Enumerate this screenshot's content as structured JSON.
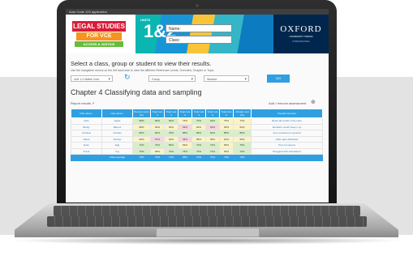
{
  "window": {
    "title": "Auto Code 123 application"
  },
  "banner": {
    "tag1": "LEGAL STUDIES",
    "tag2": "FOR VCE",
    "tag3": "ACCESS & JUSTICE",
    "units_label": "UNITS",
    "units_number": "1&2",
    "name_label": "Name:",
    "class_label": "Class:",
    "publisher": "OXFORD",
    "publisher_sub": "UNIVERSITY PRESS",
    "publisher_sub2": "INTRODUCING"
  },
  "select_heading": "Select a class, group or student to view their results.",
  "instructions": "Use the navigation menus on the left hand side to view the different Reference Levels, Overview, Chapter or Topic.",
  "filters": {
    "class": "Unit 1-2 Maths Core",
    "group": "Group",
    "student": "Student",
    "go": "GO"
  },
  "chapter_title": "Chapter 4 Classifying data and sampling",
  "export_label": "Report results",
  "add_remove_label": "Add / remove assessment",
  "table": {
    "headers": [
      "First name ↕",
      "Last name ↕",
      "Pre-test score (%)",
      "Topic test 1",
      "Topic test 2",
      "Topic test 3",
      "Topic test 4",
      "Topic test 5",
      "Topic test 6",
      "Chapter test (%)",
      "Overall comment"
    ],
    "rows": [
      {
        "cells": [
          "Alice",
          "Agate",
          "68%",
          "80%",
          "90%",
          "73%",
          "70%",
          "92%",
          "75%",
          "72%",
          "Reset all results in the topic"
        ],
        "colors": [
          "",
          "",
          "g",
          "g",
          "g",
          "y",
          "g",
          "g",
          "y",
          "y",
          ""
        ]
      },
      {
        "cells": [
          "Becky",
          "Barnes",
          "58%",
          "60%",
          "60%",
          "53%",
          "60%",
          "52%",
          "65%",
          "62%",
          "Excellent result! Keep it up"
        ],
        "colors": [
          "",
          "",
          "y",
          "y",
          "y",
          "p",
          "y",
          "p",
          "y",
          "y",
          ""
        ]
      },
      {
        "cells": [
          "Caroline",
          "Charles",
          "80%",
          "82%",
          "78%",
          "88%",
          "80%",
          "81%",
          "85%",
          "86%",
          "Very consistent in general"
        ],
        "colors": [
          "",
          "",
          "g",
          "g",
          "g",
          "g",
          "g",
          "g",
          "g",
          "g",
          ""
        ]
      },
      {
        "cells": [
          "Diane",
          "Dunlop",
          "60%",
          "57%",
          "60%",
          "45%",
          "58%",
          "55%",
          "62%",
          "59%",
          "Often gets distracted"
        ],
        "colors": [
          "",
          "",
          "y",
          "p",
          "y",
          "p",
          "y",
          "y",
          "y",
          "y",
          ""
        ]
      },
      {
        "cells": [
          "Evan",
          "Egg",
          "72%",
          "70%",
          "80%",
          "69%",
          "72%",
          "74%",
          "69%",
          "75%",
          "Tries to improve"
        ],
        "colors": [
          "",
          "",
          "g",
          "g",
          "g",
          "y",
          "g",
          "g",
          "y",
          "g",
          ""
        ]
      },
      {
        "cells": [
          "Frank",
          "Fig",
          "70%",
          "68%",
          "72%",
          "73%",
          "70%",
          "71%",
          "69%",
          "72%",
          "Struggled with calculations"
        ],
        "colors": [
          "",
          "",
          "g",
          "y",
          "g",
          "g",
          "g",
          "g",
          "y",
          "g",
          ""
        ]
      }
    ],
    "average": [
      "Class average",
      "70%",
      "72%",
      "74%",
      "68%",
      "72%",
      "71%",
      "73%",
      "72%",
      ""
    ]
  }
}
